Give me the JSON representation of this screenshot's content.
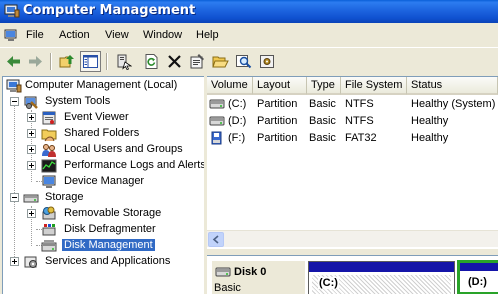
{
  "window": {
    "title": "Computer Management"
  },
  "menu": [
    "File",
    "Action",
    "View",
    "Window",
    "Help"
  ],
  "toolbar": {
    "buttons": [
      "back-arrow-icon",
      "forward-arrow-icon",
      "up-folder-icon",
      "show-hide-tree-icon",
      "connect-icon",
      "refresh-icon",
      "delete-icon",
      "properties-icon",
      "open-folder-icon",
      "search-icon",
      "settings-icon"
    ]
  },
  "tree": {
    "root": "Computer Management (Local)",
    "system_tools": "System Tools",
    "event_viewer": "Event Viewer",
    "shared_folders": "Shared Folders",
    "local_users": "Local Users and Groups",
    "perf_logs": "Performance Logs and Alerts",
    "device_manager": "Device Manager",
    "storage": "Storage",
    "removable_storage": "Removable Storage",
    "disk_defrag": "Disk Defragmenter",
    "disk_management": "Disk Management",
    "services_apps": "Services and Applications"
  },
  "volumes": {
    "columns": [
      "Volume",
      "Layout",
      "Type",
      "File System",
      "Status"
    ],
    "rows": [
      {
        "volume": "(C:)",
        "layout": "Partition",
        "type": "Basic",
        "fs": "NTFS",
        "status": "Healthy (System)"
      },
      {
        "volume": "(D:)",
        "layout": "Partition",
        "type": "Basic",
        "fs": "NTFS",
        "status": "Healthy"
      },
      {
        "volume": "(F:)",
        "layout": "Partition",
        "type": "Basic",
        "fs": "FAT32",
        "status": "Healthy"
      }
    ]
  },
  "disk_view": {
    "disk_name": "Disk 0",
    "disk_type": "Basic",
    "partition_c": "(C:)",
    "partition_d": "(D:)"
  },
  "colors": {
    "title_bar": "#0a5fd8",
    "selection": "#316ac5",
    "partition_bar": "#1414a8",
    "partition_selected": "#29a329"
  }
}
